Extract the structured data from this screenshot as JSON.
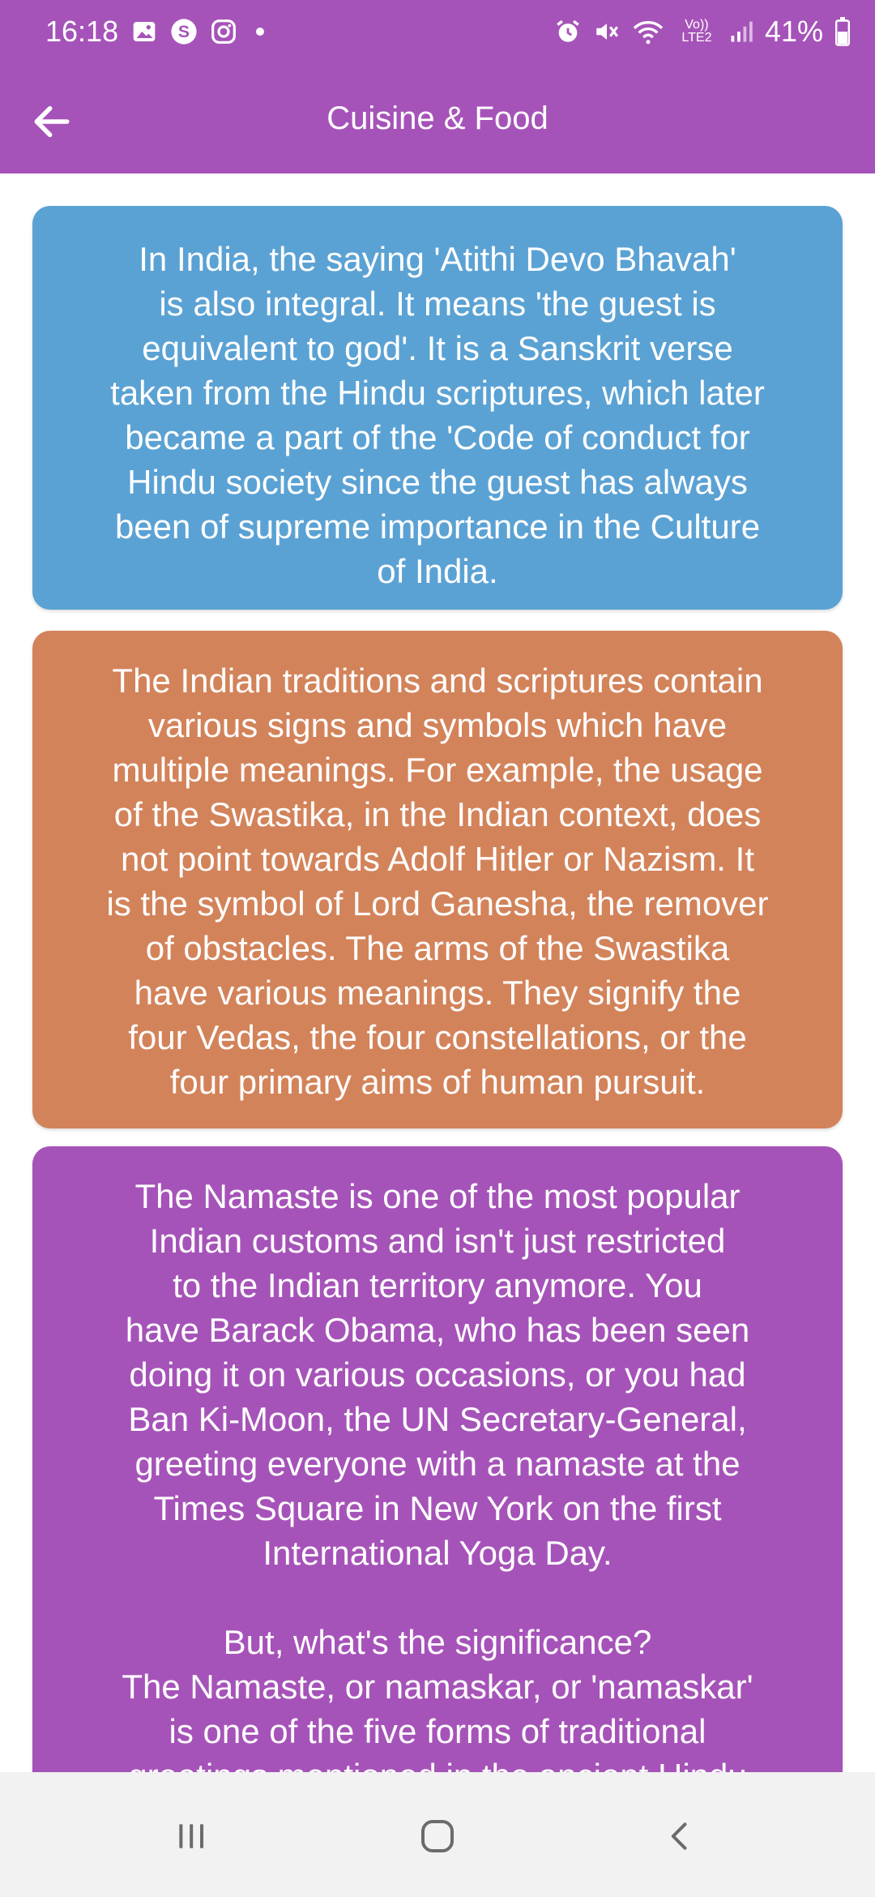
{
  "status_bar": {
    "time": "16:18",
    "battery": "41%",
    "network": "Vo)) LTE2",
    "icons": [
      "gallery-icon",
      "skype-icon",
      "instagram-icon",
      "alarm-icon",
      "mute-icon",
      "wifi-icon",
      "signal-icon",
      "battery-icon"
    ]
  },
  "app_bar": {
    "title": "Cuisine & Food",
    "back_icon": "arrow-left-icon"
  },
  "cards": [
    {
      "color": "#5ba2d4",
      "text": "In India, the saying 'Atithi Devo Bhavah'\nis also integral. It means 'the guest is\nequivalent to god'. It is a Sanskrit verse\ntaken from the Hindu scriptures, which later\nbecame a part of the 'Code of conduct for\nHindu society since the guest has always\nbeen of supreme importance in the Culture\nof India."
    },
    {
      "color": "#d3835a",
      "text": "The Indian traditions and scriptures contain\nvarious signs and symbols which have\nmultiple meanings. For example, the usage\nof the Swastika, in the Indian context, does\nnot point towards Adolf Hitler or Nazism. It\nis the symbol of Lord Ganesha, the remover\nof obstacles. The arms of the Swastika\nhave various meanings. They signify the\nfour Vedas, the four constellations, or the\nfour primary aims of human pursuit."
    },
    {
      "color": "#a653b9",
      "text": "The Namaste is one of the most popular\nIndian customs and isn't just restricted\nto the Indian territory anymore. You\nhave Barack Obama, who has been seen\ndoing it on various occasions, or you had\nBan Ki-Moon, the UN Secretary-General,\ngreeting everyone with a namaste at the\nTimes Square in New York on the first\nInternational Yoga Day.\n\nBut, what's the significance?\nThe Namaste, or namaskar, or 'namaskar'\nis one of the five forms of traditional\ngreetings mentioned in the ancient Hindu"
    }
  ],
  "nav_bar": {
    "buttons": [
      "recent-apps-icon",
      "home-icon",
      "back-icon"
    ]
  }
}
